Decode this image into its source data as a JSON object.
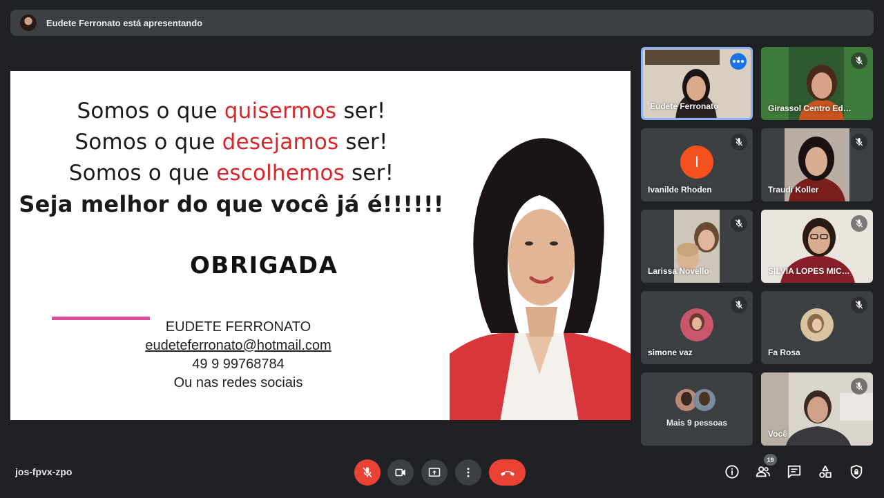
{
  "banner": {
    "presenter_text": "Eudete Ferronato está apresentando"
  },
  "slide": {
    "line1_a": "Somos o que ",
    "line1_red": "quisermos",
    "line1_b": " ser!",
    "line2_a": "Somos o que ",
    "line2_red": "desejamos",
    "line2_b": " ser!",
    "line3_a": "Somos o que ",
    "line3_red": "escolhemos",
    "line3_b": " ser!",
    "line4": "Seja melhor do que você já é!!!!!!",
    "thanks": "OBRIGADA",
    "contact_name": "EUDETE FERRONATO",
    "contact_email": "eudeteferronato@hotmail.com",
    "contact_phone": "49 9 99768784",
    "contact_social": "Ou nas redes sociais"
  },
  "participants": [
    {
      "name": "Eudete Ferronato"
    },
    {
      "name": "Girassol Centro Ed…"
    },
    {
      "name": "Ivanilde Rhoden",
      "initial": "I"
    },
    {
      "name": "Traudi Koller"
    },
    {
      "name": "Larissa Novello"
    },
    {
      "name": "SILVIA LOPES MIC…"
    },
    {
      "name": "simone vaz"
    },
    {
      "name": "Fa Rosa"
    },
    {
      "name": "Mais 9 pessoas"
    },
    {
      "name": "Você"
    }
  ],
  "footer": {
    "meeting_code": "jos-fpvx-zpo",
    "participant_count": "19"
  },
  "colors": {
    "background": "#202124",
    "tile": "#3c4043",
    "accent_red": "#ea4335",
    "active_border": "#8ab4f8",
    "slide_red": "#d9262b"
  }
}
